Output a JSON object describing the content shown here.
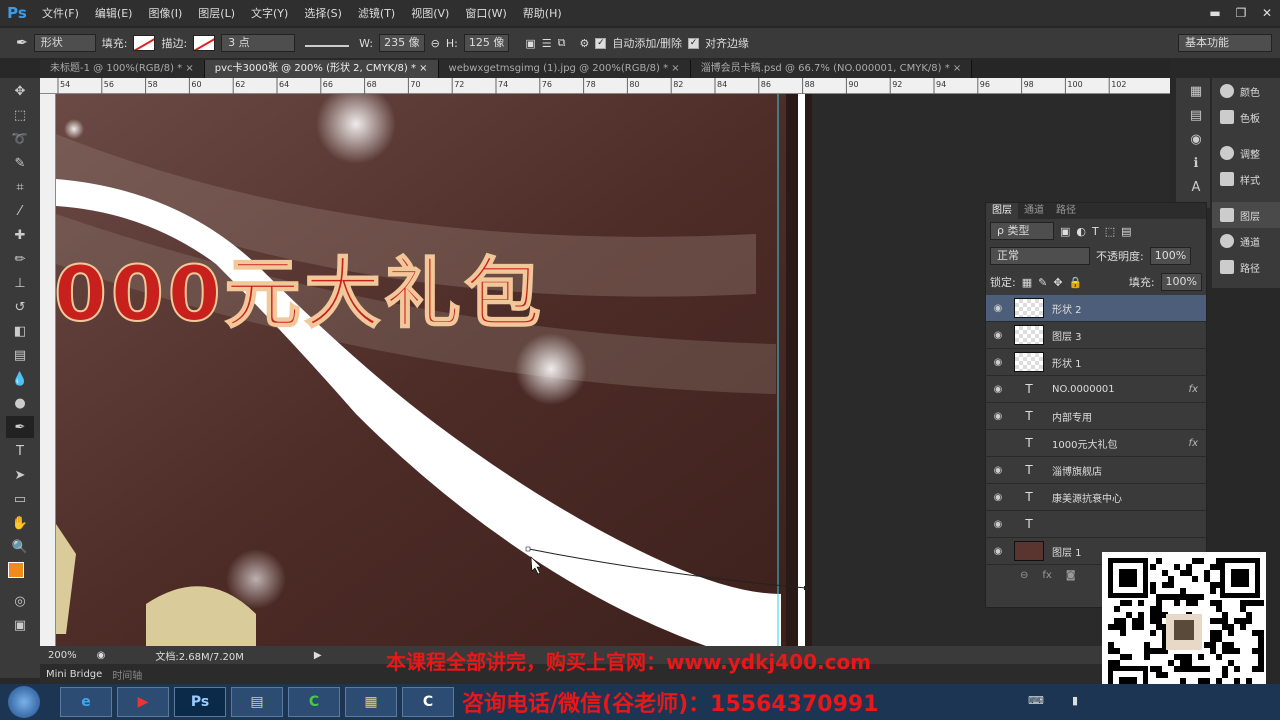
{
  "menubar": {
    "logo": "Ps",
    "items": [
      "文件(F)",
      "编辑(E)",
      "图像(I)",
      "图层(L)",
      "文字(Y)",
      "选择(S)",
      "滤镜(T)",
      "视图(V)",
      "窗口(W)",
      "帮助(H)"
    ]
  },
  "options": {
    "mode": "形状",
    "fill_label": "填充:",
    "stroke_label": "描边:",
    "stroke_size": "3 点",
    "w_label": "W:",
    "w_value": "235 像",
    "h_label": "H:",
    "h_value": "125 像",
    "auto_add_delete": "自动添加/删除",
    "align_edges": "对齐边缘",
    "workspace": "基本功能"
  },
  "tabs": [
    "未标题-1 @ 100%(RGB/8) *",
    "pvc卡3000张 @ 200% (形状 2, CMYK/8) *",
    "webwxgetmsgimg (1).jpg @ 200%(RGB/8) *",
    "淄博会员卡稿.psd @ 66.7% (NO.000001, CMYK/8) *"
  ],
  "ruler_top": [
    "54",
    "56",
    "58",
    "60",
    "62",
    "64",
    "66",
    "68",
    "70",
    "72",
    "74",
    "76",
    "78",
    "80",
    "82",
    "84",
    "86",
    "88",
    "90",
    "92",
    "94",
    "96",
    "98",
    "100",
    "102"
  ],
  "canvas": {
    "headline": "000元大礼包"
  },
  "status": {
    "zoom": "200%",
    "doc": "文档:2.68M/7.20M"
  },
  "minibridge": {
    "tab1": "Mini Bridge",
    "tab2": "时间轴"
  },
  "right_panels": [
    "颜色",
    "色板",
    "调整",
    "样式",
    "图层",
    "通道",
    "路径"
  ],
  "layers": {
    "tabs": [
      "图层",
      "通道",
      "路径"
    ],
    "filter": "ρ 类型",
    "blend": "正常",
    "opacity_label": "不透明度:",
    "opacity": "100%",
    "lock_label": "锁定:",
    "fill_label": "填充:",
    "fill": "100%",
    "rows": [
      {
        "name": "形状 2",
        "kind": "shape",
        "fx": ""
      },
      {
        "name": "图层 3",
        "kind": "pixel",
        "fx": ""
      },
      {
        "name": "形状 1",
        "kind": "shape",
        "fx": ""
      },
      {
        "name": "NO.0000001",
        "kind": "text",
        "fx": "fx"
      },
      {
        "name": "内部专用",
        "kind": "text",
        "fx": ""
      },
      {
        "name": "1000元大礼包",
        "kind": "text",
        "fx": "fx"
      },
      {
        "name": "淄博旗舰店",
        "kind": "text",
        "fx": ""
      },
      {
        "name": "康美源抗衰中心",
        "kind": "text",
        "fx": ""
      },
      {
        "name": "",
        "kind": "text",
        "fx": ""
      },
      {
        "name": "图层 1",
        "kind": "pixel",
        "fx": ""
      }
    ]
  },
  "promo": {
    "line1": "本课程全部讲完，购买上官网：www.ydkj400.com",
    "line2": "咨询电话/微信(谷老师)：15564370991"
  },
  "colors": {
    "canvas_bg": "#4a2a25",
    "headline": "#c8201c",
    "fg_color": "#f08a1c",
    "promo": "#e81818"
  }
}
